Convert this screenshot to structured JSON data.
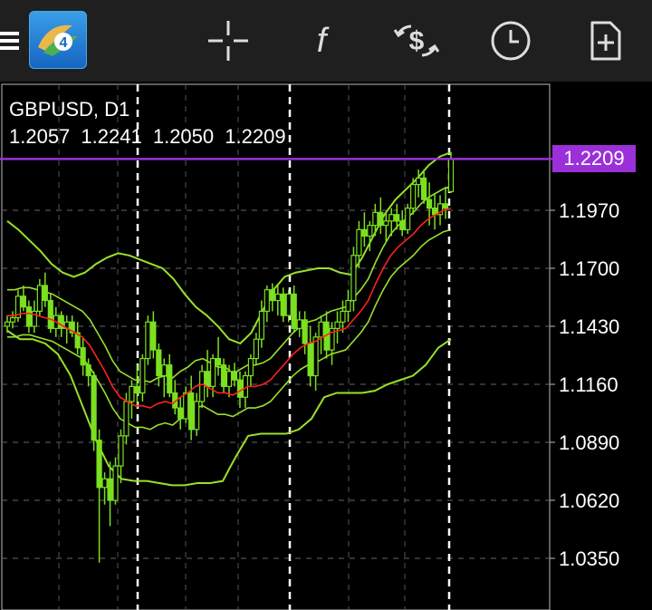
{
  "toolbar": {
    "menu_icon": "hamburger-menu-icon",
    "logo_icon": "metatrader-4-logo-icon",
    "logo_text": "4",
    "buttons": [
      {
        "name": "crosshair-button",
        "icon": "crosshair-icon"
      },
      {
        "name": "indicators-button",
        "icon": "function-f-icon",
        "glyph": "f"
      },
      {
        "name": "trade-button",
        "icon": "dollar-exchange-icon",
        "glyph": "$"
      },
      {
        "name": "timeframe-button",
        "icon": "clock-icon"
      },
      {
        "name": "new-order-button",
        "icon": "document-plus-icon"
      }
    ]
  },
  "chart": {
    "symbol_label": "GBPUSD, D1",
    "ohlc": {
      "open": "1.2057",
      "high": "1.2241",
      "low": "1.2050",
      "close": "1.2209"
    },
    "current_price_label": "1.2209",
    "price_line_color": "#9b30d9",
    "candle_color": "#7be01f",
    "ma_color": "#ff2020",
    "bands_color": "#9ae02a",
    "background": "#000000"
  },
  "chart_data": {
    "type": "candlestick",
    "symbol": "GBPUSD",
    "timeframe": "D1",
    "y_ticks": [
      "1.1970",
      "1.1700",
      "1.1430",
      "1.1160",
      "1.0890",
      "1.0620",
      "1.0350"
    ],
    "y_range": [
      1.025,
      1.266
    ],
    "current_price": 1.2209,
    "candles": [
      [
        1.143,
        1.148,
        1.14,
        1.145
      ],
      [
        1.145,
        1.15,
        1.142,
        1.147
      ],
      [
        1.147,
        1.16,
        1.145,
        1.157
      ],
      [
        1.157,
        1.162,
        1.15,
        1.152
      ],
      [
        1.152,
        1.155,
        1.14,
        1.143
      ],
      [
        1.143,
        1.155,
        1.14,
        1.15
      ],
      [
        1.15,
        1.165,
        1.148,
        1.162
      ],
      [
        1.162,
        1.168,
        1.152,
        1.155
      ],
      [
        1.155,
        1.158,
        1.14,
        1.142
      ],
      [
        1.142,
        1.152,
        1.138,
        1.148
      ],
      [
        1.148,
        1.15,
        1.138,
        1.142
      ],
      [
        1.142,
        1.148,
        1.135,
        1.145
      ],
      [
        1.145,
        1.148,
        1.138,
        1.14
      ],
      [
        1.14,
        1.145,
        1.13,
        1.133
      ],
      [
        1.133,
        1.138,
        1.12,
        1.125
      ],
      [
        1.125,
        1.128,
        1.115,
        1.12
      ],
      [
        1.12,
        1.122,
        1.085,
        1.09
      ],
      [
        1.09,
        1.095,
        1.033,
        1.068
      ],
      [
        1.068,
        1.075,
        1.06,
        1.072
      ],
      [
        1.072,
        1.08,
        1.05,
        1.062
      ],
      [
        1.062,
        1.082,
        1.06,
        1.078
      ],
      [
        1.078,
        1.095,
        1.07,
        1.092
      ],
      [
        1.092,
        1.112,
        1.088,
        1.108
      ],
      [
        1.108,
        1.118,
        1.1,
        1.115
      ],
      [
        1.115,
        1.125,
        1.105,
        1.112
      ],
      [
        1.112,
        1.13,
        1.108,
        1.128
      ],
      [
        1.128,
        1.148,
        1.125,
        1.145
      ],
      [
        1.145,
        1.15,
        1.128,
        1.132
      ],
      [
        1.132,
        1.135,
        1.115,
        1.12
      ],
      [
        1.12,
        1.128,
        1.11,
        1.125
      ],
      [
        1.125,
        1.13,
        1.11,
        1.112
      ],
      [
        1.112,
        1.118,
        1.102,
        1.105
      ],
      [
        1.105,
        1.11,
        1.095,
        1.1
      ],
      [
        1.1,
        1.115,
        1.098,
        1.112
      ],
      [
        1.112,
        1.12,
        1.09,
        1.095
      ],
      [
        1.095,
        1.112,
        1.092,
        1.108
      ],
      [
        1.108,
        1.125,
        1.105,
        1.122
      ],
      [
        1.122,
        1.132,
        1.11,
        1.115
      ],
      [
        1.115,
        1.13,
        1.11,
        1.128
      ],
      [
        1.128,
        1.138,
        1.12,
        1.125
      ],
      [
        1.125,
        1.128,
        1.112,
        1.115
      ],
      [
        1.115,
        1.125,
        1.11,
        1.122
      ],
      [
        1.122,
        1.126,
        1.115,
        1.118
      ],
      [
        1.118,
        1.122,
        1.105,
        1.11
      ],
      [
        1.11,
        1.122,
        1.105,
        1.12
      ],
      [
        1.12,
        1.13,
        1.115,
        1.128
      ],
      [
        1.128,
        1.14,
        1.125,
        1.137
      ],
      [
        1.137,
        1.155,
        1.133,
        1.15
      ],
      [
        1.15,
        1.162,
        1.145,
        1.16
      ],
      [
        1.16,
        1.163,
        1.15,
        1.155
      ],
      [
        1.155,
        1.162,
        1.148,
        1.158
      ],
      [
        1.158,
        1.161,
        1.145,
        1.148
      ],
      [
        1.148,
        1.16,
        1.145,
        1.158
      ],
      [
        1.158,
        1.162,
        1.14,
        1.142
      ],
      [
        1.142,
        1.15,
        1.138,
        1.146
      ],
      [
        1.146,
        1.15,
        1.13,
        1.135
      ],
      [
        1.135,
        1.143,
        1.115,
        1.12
      ],
      [
        1.12,
        1.14,
        1.113,
        1.138
      ],
      [
        1.138,
        1.148,
        1.13,
        1.145
      ],
      [
        1.145,
        1.15,
        1.128,
        1.132
      ],
      [
        1.132,
        1.145,
        1.125,
        1.142
      ],
      [
        1.142,
        1.15,
        1.135,
        1.145
      ],
      [
        1.145,
        1.155,
        1.14,
        1.15
      ],
      [
        1.15,
        1.16,
        1.145,
        1.155
      ],
      [
        1.155,
        1.18,
        1.15,
        1.176
      ],
      [
        1.176,
        1.192,
        1.17,
        1.188
      ],
      [
        1.188,
        1.196,
        1.18,
        1.185
      ],
      [
        1.185,
        1.192,
        1.178,
        1.19
      ],
      [
        1.19,
        1.2,
        1.185,
        1.196
      ],
      [
        1.196,
        1.203,
        1.186,
        1.19
      ],
      [
        1.19,
        1.196,
        1.182,
        1.192
      ],
      [
        1.192,
        1.198,
        1.185,
        1.195
      ],
      [
        1.195,
        1.2,
        1.188,
        1.192
      ],
      [
        1.192,
        1.197,
        1.185,
        1.188
      ],
      [
        1.188,
        1.2,
        1.186,
        1.198
      ],
      [
        1.198,
        1.212,
        1.195,
        1.209
      ],
      [
        1.209,
        1.216,
        1.203,
        1.212
      ],
      [
        1.212,
        1.216,
        1.2,
        1.202
      ],
      [
        1.202,
        1.21,
        1.19,
        1.198
      ],
      [
        1.198,
        1.205,
        1.188,
        1.195
      ],
      [
        1.195,
        1.204,
        1.19,
        1.2
      ],
      [
        1.2,
        1.208,
        1.193,
        1.198
      ],
      [
        1.2057,
        1.2241,
        1.205,
        1.2209
      ]
    ],
    "ma": [
      1.148,
      1.148,
      1.149,
      1.149,
      1.148,
      1.147,
      1.146,
      1.144,
      1.142,
      1.14,
      1.138,
      1.134,
      1.128,
      1.122,
      1.115,
      1.11,
      1.108,
      1.106,
      1.106,
      1.105,
      1.107,
      1.108,
      1.107,
      1.11,
      1.112,
      1.115,
      1.116,
      1.114,
      1.112,
      1.112,
      1.111,
      1.113,
      1.115,
      1.115,
      1.116,
      1.118,
      1.122,
      1.126,
      1.13,
      1.133,
      1.135,
      1.136,
      1.138,
      1.14,
      1.141,
      1.142,
      1.146,
      1.15,
      1.155,
      1.163,
      1.17,
      1.176,
      1.18,
      1.183,
      1.186,
      1.19,
      1.193,
      1.195,
      1.197,
      1.198
    ],
    "upper_band": [
      1.192,
      1.188,
      1.183,
      1.178,
      1.172,
      1.168,
      1.166,
      1.168,
      1.172,
      1.175,
      1.177,
      1.176,
      1.174,
      1.172,
      1.17,
      1.165,
      1.158,
      1.152,
      1.148,
      1.143,
      1.137,
      1.135,
      1.14,
      1.15,
      1.16,
      1.166,
      1.168,
      1.169,
      1.17,
      1.17,
      1.168,
      1.167,
      1.175,
      1.185,
      1.195,
      1.202,
      1.207,
      1.212,
      1.218,
      1.222,
      1.224
    ],
    "lower_band": [
      1.141,
      1.137,
      1.137,
      1.135,
      1.13,
      1.12,
      1.105,
      1.09,
      1.078,
      1.072,
      1.071,
      1.071,
      1.07,
      1.069,
      1.069,
      1.07,
      1.07,
      1.071,
      1.082,
      1.092,
      1.093,
      1.093,
      1.093,
      1.095,
      1.1,
      1.11,
      1.112,
      1.112,
      1.112,
      1.113,
      1.116,
      1.118,
      1.12,
      1.125,
      1.133,
      1.137
    ]
  }
}
